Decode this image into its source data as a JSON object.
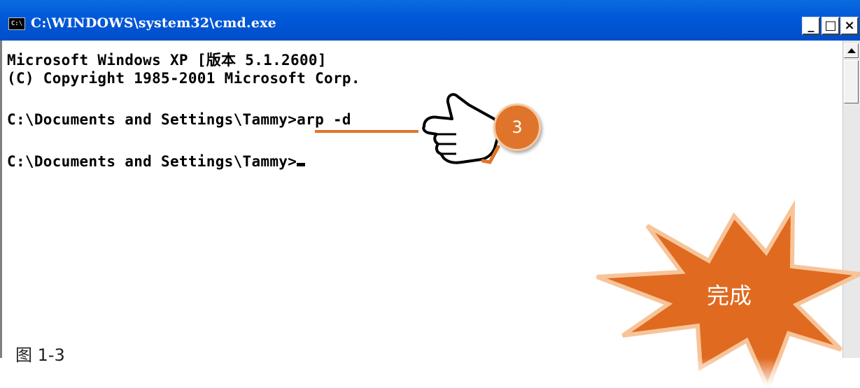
{
  "window": {
    "title": "C:\\WINDOWS\\system32\\cmd.exe",
    "icon_text": "C:\\",
    "controls": {
      "minimize": "_",
      "maximize": "□",
      "close": "×"
    }
  },
  "console": {
    "lines": [
      "Microsoft Windows XP [版本 5.1.2600]",
      "(C) Copyright 1985-2001 Microsoft Corp.",
      "C:\\Documents and Settings\\Tammy>arp -d",
      "C:\\Documents and Settings\\Tammy>"
    ]
  },
  "annotations": {
    "step_number": "3",
    "burst_text": "完成",
    "figure_label": "图 1-3",
    "accent_color": "#e0742a"
  },
  "icons": [
    "cmd-icon",
    "pointing-hand-icon",
    "scroll-up-arrow-icon"
  ]
}
